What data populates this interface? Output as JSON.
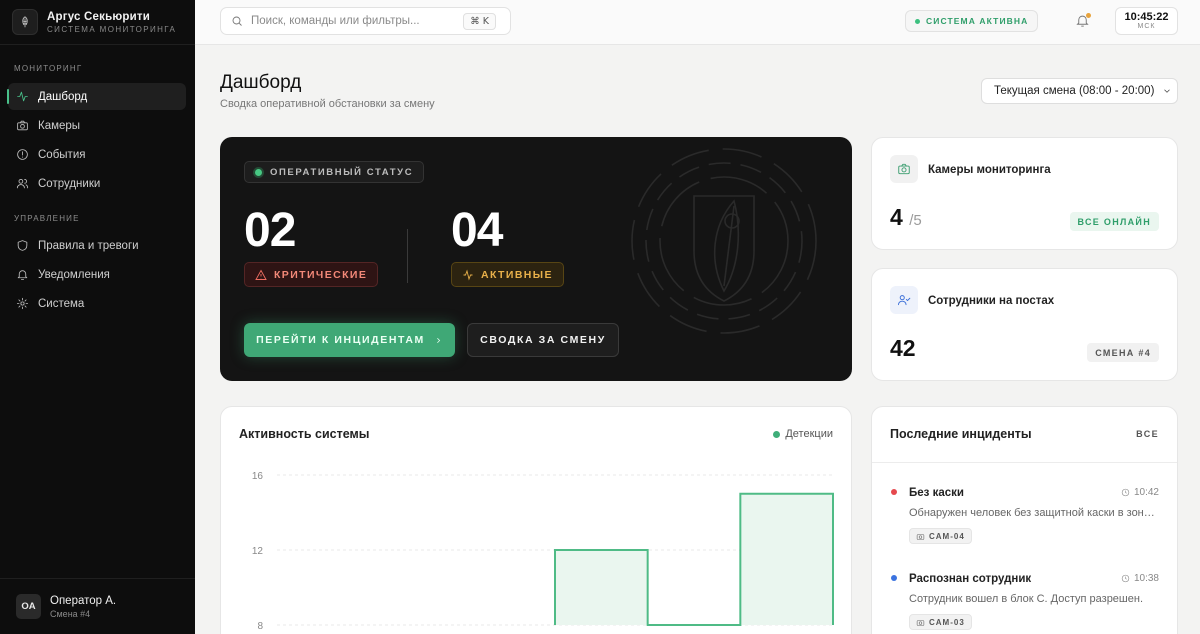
{
  "brand": {
    "title": "Аргус Секьюрити",
    "subtitle": "Система мониторинга"
  },
  "sidebar": {
    "section_monitoring": "Мониторинг",
    "monitoring_items": [
      {
        "label": "Дашборд",
        "icon": "activity-icon",
        "active": true
      },
      {
        "label": "Камеры",
        "icon": "camera-icon"
      },
      {
        "label": "События",
        "icon": "alert-circle-icon"
      },
      {
        "label": "Сотрудники",
        "icon": "users-icon"
      }
    ],
    "section_management": "Управление",
    "management_items": [
      {
        "label": "Правила и тревоги",
        "icon": "shield-icon"
      },
      {
        "label": "Уведомления",
        "icon": "bell-icon"
      },
      {
        "label": "Система",
        "icon": "gear-icon"
      }
    ]
  },
  "user": {
    "initials": "OA",
    "name": "Оператор А.",
    "shift": "Смена #4"
  },
  "topbar": {
    "search_placeholder": "Поиск, команды или фильтры...",
    "shortcut": "⌘ K",
    "system_status": "СИСТЕМА АКТИВНА",
    "time": "10:45:22",
    "timezone": "МСК"
  },
  "page": {
    "title": "Дашборд",
    "subtitle": "Сводка оперативной обстановки за смену",
    "shift_select": "Текущая смена (08:00 - 20:00)"
  },
  "hero": {
    "tag": "ОПЕРАТИВНЫЙ СТАТУС",
    "critical_count": "02",
    "critical_label": "КРИТИЧЕСКИЕ",
    "active_count": "04",
    "active_label": "АКТИВНЫЕ",
    "primary_button": "ПЕРЕЙТИ К ИНЦИДЕНТАМ",
    "secondary_button": "СВОДКА ЗА СМЕНУ"
  },
  "cameras_card": {
    "title": "Камеры мониторинга",
    "value": "4",
    "total": "/5",
    "badge": "ВСЕ ОНЛАЙН"
  },
  "staff_card": {
    "title": "Сотрудники на постах",
    "value": "42",
    "badge": "СМЕНА #4"
  },
  "chart_card": {
    "title": "Активность системы"
  },
  "chart_data": {
    "type": "area",
    "step": true,
    "title": "Активность системы",
    "legend": [
      "Детекции"
    ],
    "legend_placement": "top-right",
    "series": [
      {
        "name": "Детекции",
        "values": [
          null,
          null,
          null,
          12,
          8,
          15
        ]
      }
    ],
    "y_ticks": [
      "16",
      "12",
      "8"
    ],
    "ylim": [
      8,
      16
    ],
    "grid": true,
    "colors": {
      "line": "#4fbb86",
      "fill": "#eaf6ef",
      "grid": "#e8e8e8"
    }
  },
  "incidents": {
    "title": "Последние инциденты",
    "all_label": "ВСЕ",
    "items": [
      {
        "name": "Без каски",
        "time": "10:42",
        "desc": "Обнаружен человек без защитной каски в зоне...",
        "camera": "CAM-04",
        "color": "#e5484d"
      },
      {
        "name": "Распознан сотрудник",
        "time": "10:38",
        "desc": "Сотрудник вошел в блок С. Доступ разрешен.",
        "camera": "CAM-03",
        "color": "#3b73e0"
      }
    ]
  },
  "colors": {
    "accent": "#3fa876",
    "critical": "#f06f62",
    "warning": "#e8b04a"
  }
}
